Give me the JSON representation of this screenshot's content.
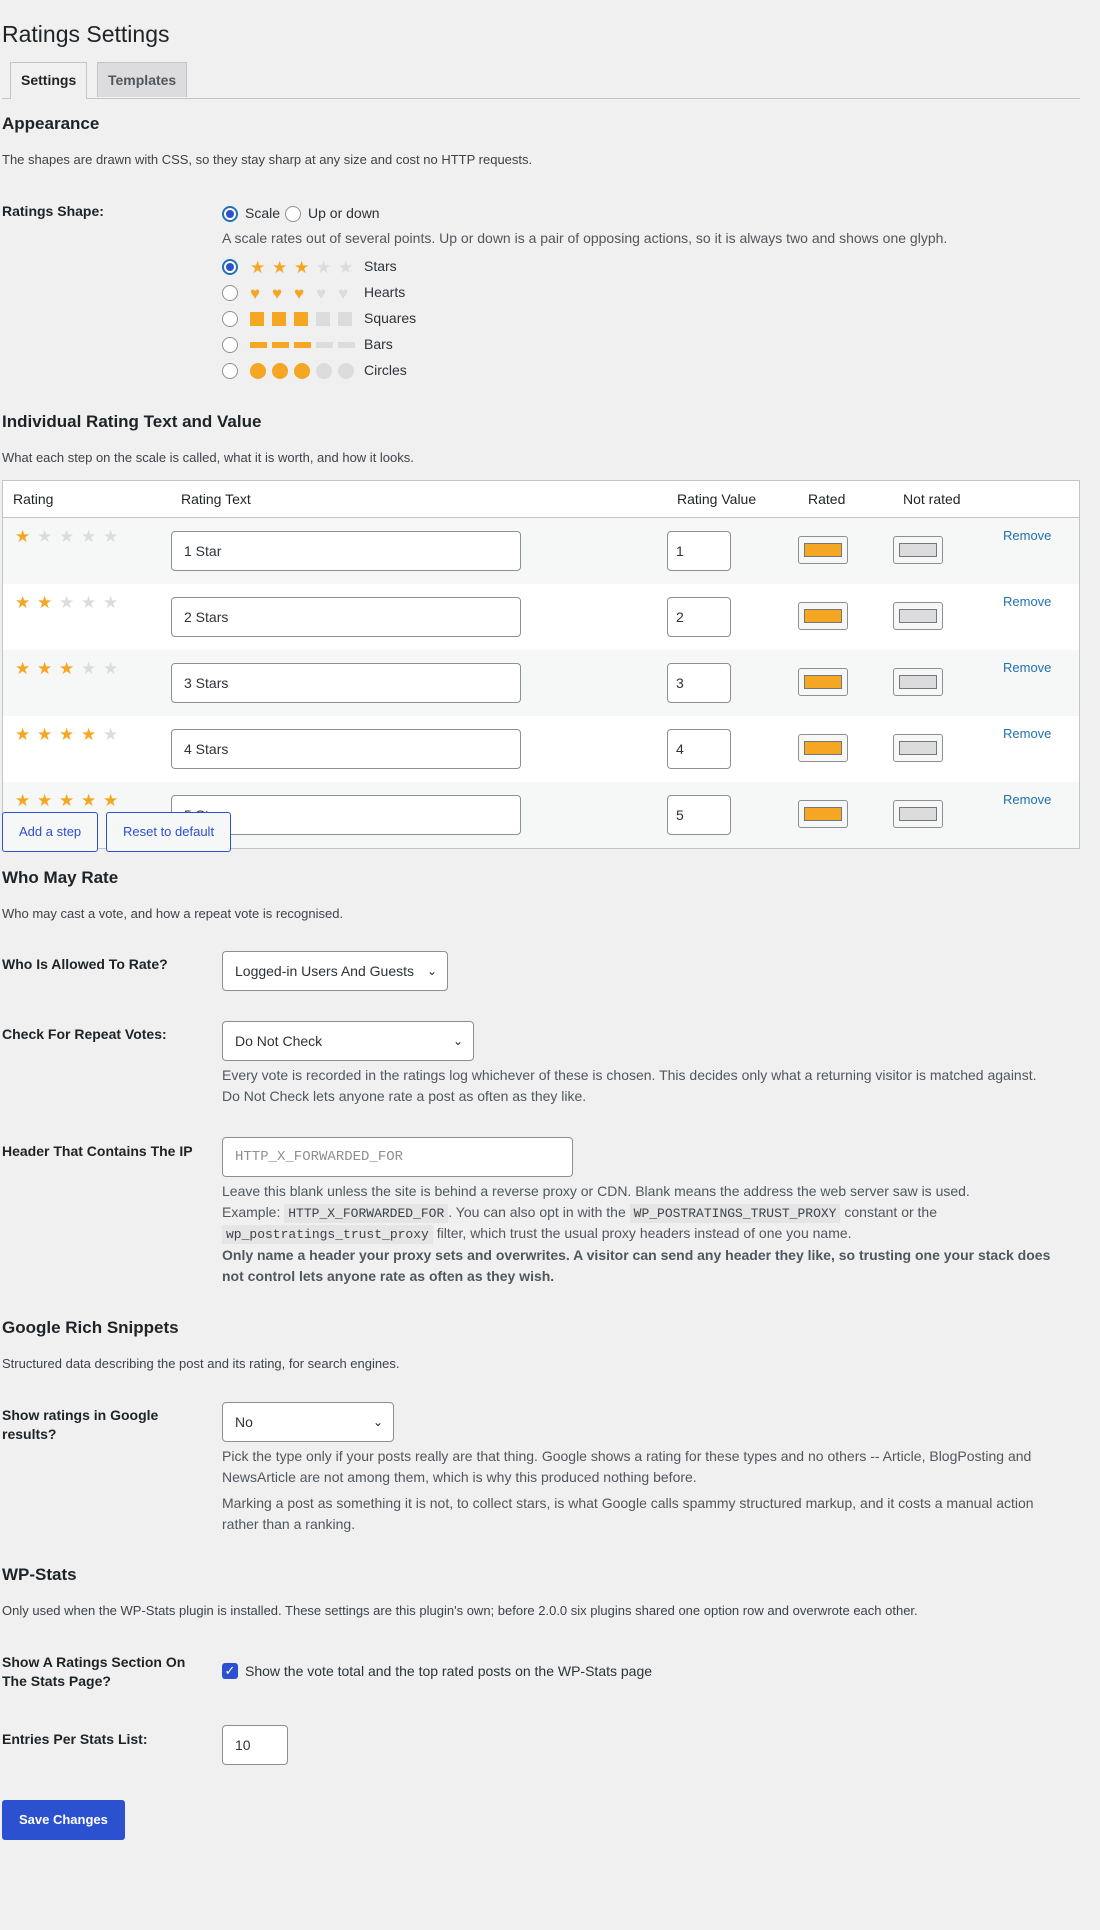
{
  "page_title": "Ratings Settings",
  "tabs": [
    {
      "label": "Settings",
      "active": true
    },
    {
      "label": "Templates",
      "active": false
    }
  ],
  "appearance": {
    "heading": "Appearance",
    "desc": "The shapes are drawn with CSS, so they stay sharp at any size and cost no HTTP requests.",
    "shape_label": "Ratings Shape:",
    "mode_options": [
      "Scale",
      "Up or down"
    ],
    "mode_selected": "Scale",
    "mode_help": "A scale rates out of several points. Up or down is a pair of opposing actions, so it is always two and shows one glyph.",
    "shapes": [
      {
        "label": "Stars",
        "icon": "star-icon",
        "selected": true
      },
      {
        "label": "Hearts",
        "icon": "heart-icon",
        "selected": false
      },
      {
        "label": "Squares",
        "icon": "square-icon",
        "selected": false
      },
      {
        "label": "Bars",
        "icon": "bar-icon",
        "selected": false
      },
      {
        "label": "Circles",
        "icon": "circle-icon",
        "selected": false
      }
    ],
    "preview_filled": 3,
    "preview_total": 5
  },
  "individual": {
    "heading": "Individual Rating Text and Value",
    "desc": "What each step on the scale is called, what it is worth, and how it looks.",
    "columns": [
      "Rating",
      "Rating Text",
      "Rating Value",
      "Rated",
      "Not rated"
    ],
    "rows": [
      {
        "stars": 1,
        "text": "1 Star",
        "value": "1"
      },
      {
        "stars": 2,
        "text": "2 Stars",
        "value": "2"
      },
      {
        "stars": 3,
        "text": "3 Stars",
        "value": "3"
      },
      {
        "stars": 4,
        "text": "4 Stars",
        "value": "4"
      },
      {
        "stars": 5,
        "text": "5 Stars",
        "value": "5"
      }
    ],
    "remove_label": "Remove",
    "rated_color": "#f5a623",
    "not_rated_color": "#dcdcde",
    "add_label": "Add a step",
    "reset_label": "Reset to default"
  },
  "who": {
    "heading": "Who May Rate",
    "desc": "Who may cast a vote, and how a repeat vote is recognised.",
    "allowed_label": "Who Is Allowed To Rate?",
    "allowed_value": "Logged-in Users And Guests",
    "repeat_label": "Check For Repeat Votes:",
    "repeat_value": "Do Not Check",
    "repeat_help": "Every vote is recorded in the ratings log whichever of these is chosen. This decides only what a returning visitor is matched against. Do Not Check lets anyone rate a post as often as they like.",
    "ip_label": "Header That Contains The IP",
    "ip_placeholder": "HTTP_X_FORWARDED_FOR",
    "ip_help1": "Leave this blank unless the site is behind a reverse proxy or CDN. Blank means the address the web server saw is used.",
    "ip_help2_a": "Example:",
    "ip_help2_code1": "HTTP_X_FORWARDED_FOR",
    "ip_help2_b": ". You can also opt in with the",
    "ip_help2_code2": "WP_POSTRATINGS_TRUST_PROXY",
    "ip_help2_c": "constant or the",
    "ip_help3_code": "wp_postratings_trust_proxy",
    "ip_help3_b": "filter, which trust the usual proxy headers instead of one you name.",
    "ip_warning": "Only name a header your proxy sets and overwrites. A visitor can send any header they like, so trusting one your stack does not control lets anyone rate as often as they wish."
  },
  "google": {
    "heading": "Google Rich Snippets",
    "desc": "Structured data describing the post and its rating, for search engines.",
    "show_label": "Show ratings in Google results?",
    "show_value": "No",
    "help1": "Pick the type only if your posts really are that thing. Google shows a rating for these types and no others -- Article, BlogPosting and NewsArticle are not among them, which is why this produced nothing before.",
    "help2": "Marking a post as something it is not, to collect stars, is what Google calls spammy structured markup, and it costs a manual action rather than a ranking."
  },
  "wpstats": {
    "heading": "WP-Stats",
    "desc": "Only used when the WP-Stats plugin is installed. These settings are this plugin's own; before 2.0.0 six plugins shared one option row and overwrote each other.",
    "section_label": "Show A Ratings Section On The Stats Page?",
    "section_checkbox": "Show the vote total and the top rated posts on the WP-Stats page",
    "section_checked": true,
    "entries_label": "Entries Per Stats List:",
    "entries_value": "10"
  },
  "save_label": "Save Changes",
  "colors": {
    "accent": "#2b51d0",
    "star": "#f5a623",
    "star_off": "#dcdcde"
  }
}
